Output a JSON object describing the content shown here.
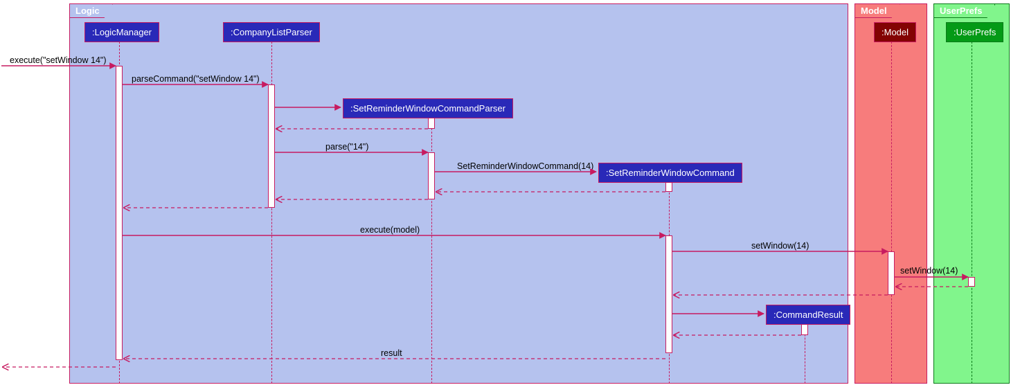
{
  "frames": {
    "logic": {
      "label": "Logic",
      "bg": "#b5c2ee",
      "border": "#c71b60",
      "label_bg": "#b5c2ee",
      "label_color": "#ffffff"
    },
    "model": {
      "label": "Model",
      "bg": "#f77c7c",
      "border": "#c71b60",
      "label_bg": "#f77c7c",
      "label_color": "#ffffff"
    },
    "userprefs": {
      "label": "UserPrefs",
      "bg": "#81f58c",
      "border": "#0b7a19",
      "label_bg": "#81f58c",
      "label_color": "#ffffff"
    }
  },
  "participants": {
    "logicManager": {
      "label": ":LogicManager",
      "bg": "#2929b8",
      "fg": "#ffffff",
      "border": "#c71b60"
    },
    "companyParser": {
      "label": ":CompanyListParser",
      "bg": "#2929b8",
      "fg": "#ffffff",
      "border": "#c71b60"
    },
    "srwCmdParser": {
      "label": ":SetReminderWindowCommandParser",
      "bg": "#2929b8",
      "fg": "#ffffff",
      "border": "#c71b60"
    },
    "srwCmd": {
      "label": ":SetReminderWindowCommand",
      "bg": "#2929b8",
      "fg": "#ffffff",
      "border": "#c71b60"
    },
    "cmdResult": {
      "label": ":CommandResult",
      "bg": "#2929b8",
      "fg": "#ffffff",
      "border": "#c71b60"
    },
    "model": {
      "label": ":Model",
      "bg": "#830303",
      "fg": "#ffffff",
      "border": "#c71b60"
    },
    "userPrefs": {
      "label": ":UserPrefs",
      "bg": "#049a16",
      "fg": "#ffffff",
      "border": "#0b7a19"
    }
  },
  "messages": {
    "m1": "execute(\"setWindow 14\")",
    "m2": "parseCommand(\"setWindow 14\")",
    "m3": "parse(\"14\")",
    "m4": "SetReminderWindowCommand(14)",
    "m5": "execute(model)",
    "m6": "setWindow(14)",
    "m7": "setWindow(14)",
    "m8": "result"
  }
}
